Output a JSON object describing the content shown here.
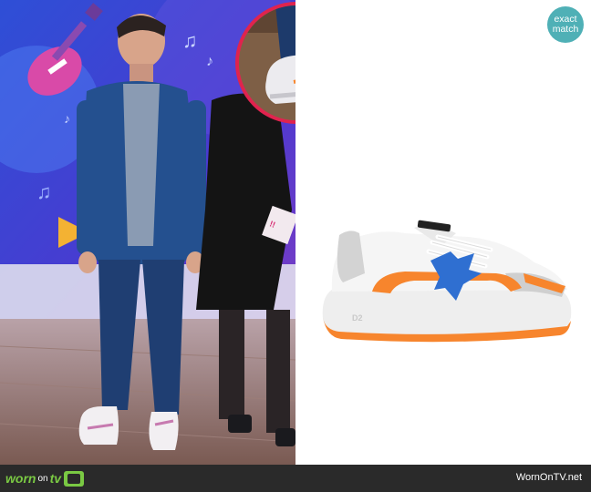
{
  "badge": {
    "line1": "exact",
    "line2": "match"
  },
  "footer": {
    "logo_part1": "worn",
    "logo_part2": "on",
    "logo_part3": "tv",
    "credit": "WornOnTV.net"
  },
  "product": {
    "sole_text": "D2"
  },
  "colors": {
    "accent_orange": "#f7852d",
    "accent_blue": "#2f6fd1",
    "ring": "#e0234e",
    "badge": "#4fb0b6"
  },
  "icons": [
    "guitar-icon",
    "music-note-icon",
    "trumpet-icon",
    "tv-icon"
  ]
}
